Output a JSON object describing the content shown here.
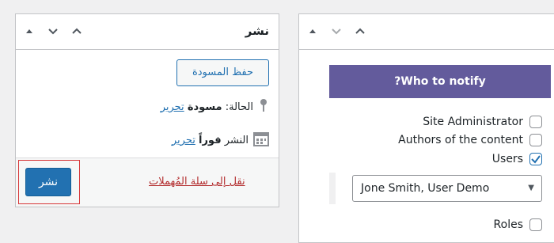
{
  "publish_box": {
    "title": "نشر",
    "save_draft_label": "حفظ المسودة",
    "status_label": "الحالة:",
    "status_value": "مسودة",
    "status_edit": "تحرير",
    "publish_label": "النشر",
    "publish_value": "فوراً",
    "publish_edit": "تحرير",
    "trash_link": "نقل إلى سلة المُهملات",
    "publish_button": "نشر",
    "icons": {
      "status": "pin-icon",
      "schedule": "calendar-icon"
    }
  },
  "notify_box": {
    "heading": "?Who to notify",
    "options": [
      {
        "label": "Site Administrator",
        "checked": false
      },
      {
        "label": "Authors of the content",
        "checked": false
      },
      {
        "label": "Users",
        "checked": true
      }
    ],
    "user_select_value": "Jone Smith, User Demo",
    "roles_option": {
      "label": "Roles",
      "checked": false
    }
  },
  "colors": {
    "accent": "#2271b1",
    "purple_header": "#635b9c",
    "trash_red": "#b32d2e",
    "highlight_red": "#d63638"
  }
}
